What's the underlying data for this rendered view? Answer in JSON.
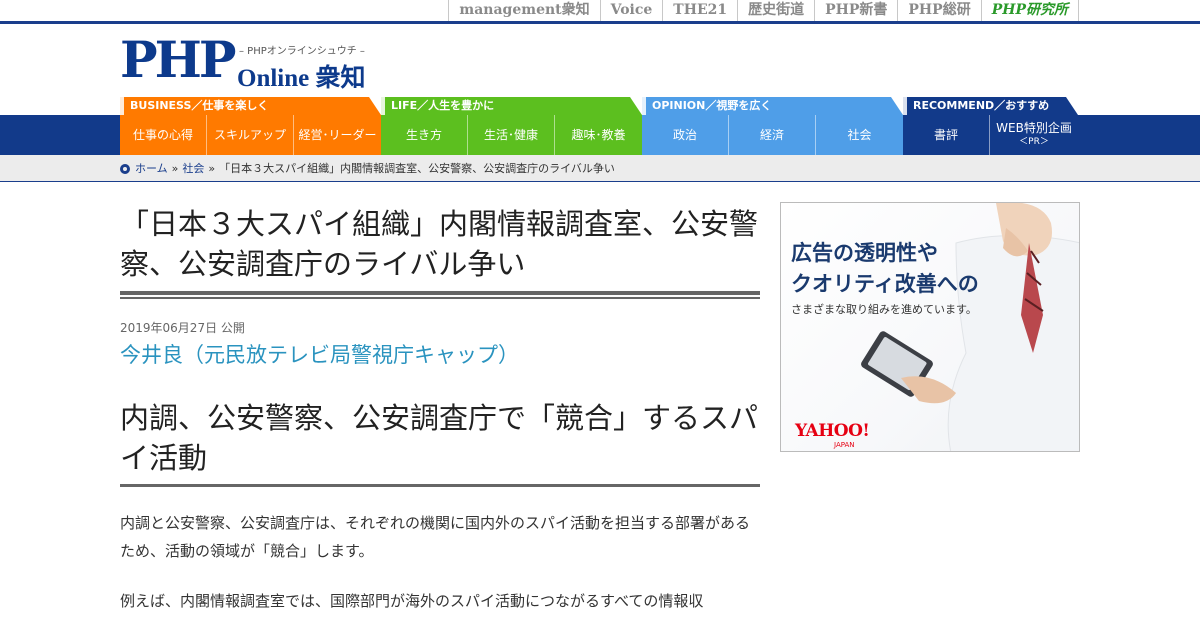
{
  "sister_sites": [
    "management衆知",
    "Voice",
    "THE21",
    "歴史街道",
    "PHP新書",
    "PHP総研",
    "PHP研究所"
  ],
  "logo": {
    "brand": "PHP",
    "online": "Online 衆知",
    "tagline": "– PHPオンラインシュウチ –"
  },
  "nav": [
    {
      "header": "BUSINESS／仕事を楽しく",
      "color": "#ff7a00",
      "items": [
        "仕事の心得",
        "スキルアップ",
        "経営･リーダー"
      ]
    },
    {
      "header": "LIFE／人生を豊かに",
      "color": "#5cbf1f",
      "items": [
        "生き方",
        "生活･健康",
        "趣味･教養"
      ]
    },
    {
      "header": "OPINION／視野を広く",
      "color": "#4f9ee8",
      "items": [
        "政治",
        "経済",
        "社会"
      ]
    },
    {
      "header": "RECOMMEND／おすすめ",
      "color": "#123a8a",
      "items": [
        "書評",
        "WEB特別企画"
      ],
      "pr_label": "＜PR＞"
    }
  ],
  "breadcrumb": {
    "home": "ホーム",
    "category": "社会",
    "current": "「日本３大スパイ組織」内閣情報調査室、公安警察、公安調査庁のライバル争い",
    "separator": "»"
  },
  "article": {
    "title": "「日本３大スパイ組織」内閣情報調査室、公安警察、公安調査庁のライバル争い",
    "date": "2019年06月27日 公開",
    "author": "今井良（元民放テレビ局警視庁キャップ）",
    "heading": "内調、公安警察、公安調査庁で「競合」するスパイ活動",
    "paragraphs": [
      "内調と公安警察、公安調査庁は、それぞれの機関に国内外のスパイ活動を担当する部署があるため、活動の領域が「競合」します。",
      "例えば、内閣情報調査室では、国際部門が海外のスパイ活動につながるすべての情報収"
    ]
  },
  "ad": {
    "line1": "広告の透明性や",
    "line2": "クオリティ改善への",
    "sub": "さまざまな取り組みを進めています。",
    "logo": "YAHOO!",
    "logo_sub": "JAPAN"
  }
}
